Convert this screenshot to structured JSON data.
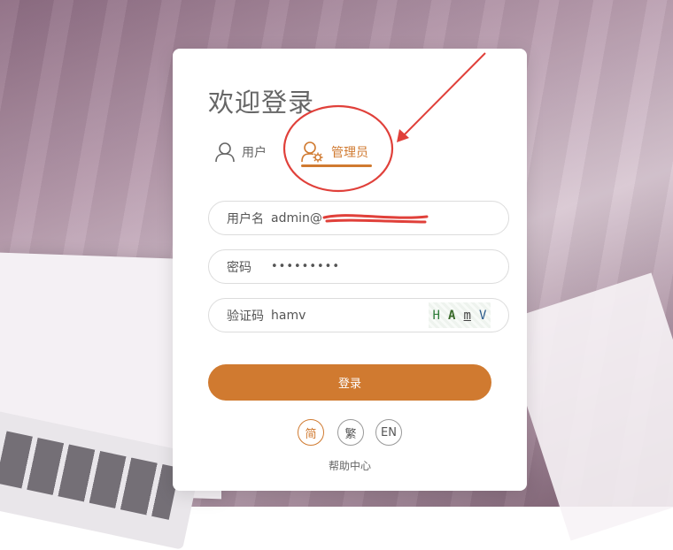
{
  "title": "欢迎登录",
  "tabs": [
    {
      "label": "用户",
      "active": false,
      "icon": "user-icon"
    },
    {
      "label": "管理员",
      "active": true,
      "icon": "admin-icon"
    }
  ],
  "fields": {
    "username": {
      "label": "用户名",
      "value": "admin@"
    },
    "password": {
      "label": "密码",
      "value": "•••••••••"
    },
    "captcha": {
      "label": "验证码",
      "value": "hamv",
      "image_chars": [
        "H",
        "A",
        "m",
        "V"
      ]
    }
  },
  "login_label": "登录",
  "languages": [
    {
      "label": "简",
      "active": true
    },
    {
      "label": "繁",
      "active": false
    },
    {
      "label": "EN",
      "active": false
    }
  ],
  "help_label": "帮助中心",
  "colors": {
    "accent": "#d07a30",
    "annotation": "#e0403a"
  }
}
